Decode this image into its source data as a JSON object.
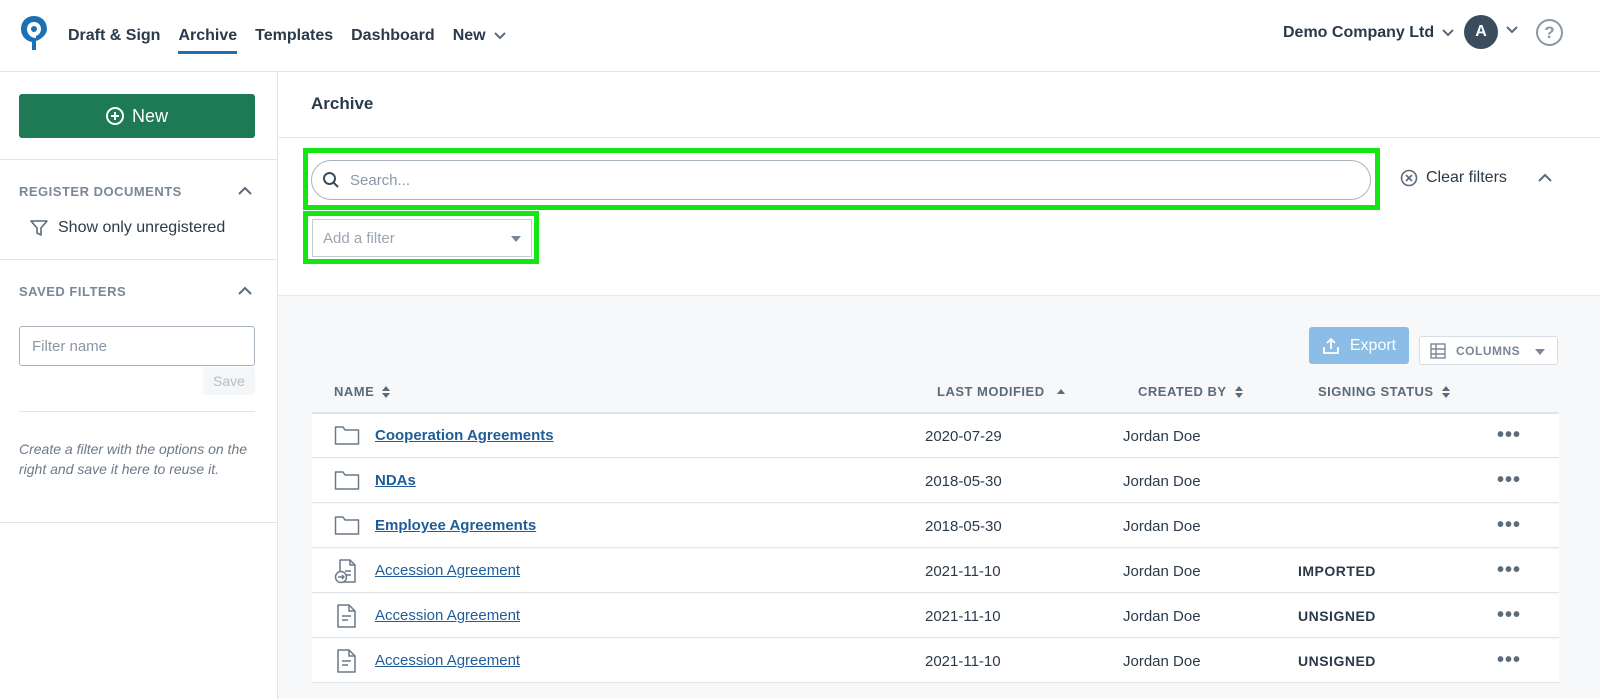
{
  "nav": {
    "items": [
      "Draft & Sign",
      "Archive",
      "Templates",
      "Dashboard",
      "New"
    ],
    "active": "Archive",
    "company": "Demo Company Ltd",
    "avatar_initial": "A",
    "help_symbol": "?"
  },
  "sidebar": {
    "new_button": "New",
    "register_heading": "REGISTER DOCUMENTS",
    "show_unregistered": "Show only unregistered",
    "saved_filters_heading": "SAVED FILTERS",
    "filter_name_placeholder": "Filter name",
    "save_label": "Save",
    "hint": "Create a filter with the options on the right and save it here to reuse it."
  },
  "main": {
    "title": "Archive",
    "search_placeholder": "Search...",
    "add_filter_placeholder": "Add a filter",
    "clear_filters": "Clear filters",
    "export_label": "Export",
    "columns_label": "COLUMNS",
    "columns": [
      "NAME",
      "LAST MODIFIED",
      "CREATED BY",
      "SIGNING STATUS"
    ],
    "rows": [
      {
        "type": "folder",
        "name": "Cooperation Agreements",
        "modified": "2020-07-29",
        "created_by": "Jordan Doe",
        "status": ""
      },
      {
        "type": "folder",
        "name": "NDAs",
        "modified": "2018-05-30",
        "created_by": "Jordan Doe",
        "status": ""
      },
      {
        "type": "folder",
        "name": "Employee Agreements",
        "modified": "2018-05-30",
        "created_by": "Jordan Doe",
        "status": ""
      },
      {
        "type": "imported-doc",
        "name": "Accession Agreement",
        "modified": "2021-11-10",
        "created_by": "Jordan Doe",
        "status": "IMPORTED"
      },
      {
        "type": "doc",
        "name": "Accession Agreement",
        "modified": "2021-11-10",
        "created_by": "Jordan Doe",
        "status": "UNSIGNED"
      },
      {
        "type": "doc",
        "name": "Accession Agreement",
        "modified": "2021-11-10",
        "created_by": "Jordan Doe",
        "status": "UNSIGNED"
      }
    ]
  },
  "colors": {
    "brand_blue": "#1f6fb5",
    "new_button_green": "#1e7a55",
    "highlight_green": "#14e614",
    "export_blue": "#8bbde6",
    "link_blue": "#1f5d99"
  }
}
